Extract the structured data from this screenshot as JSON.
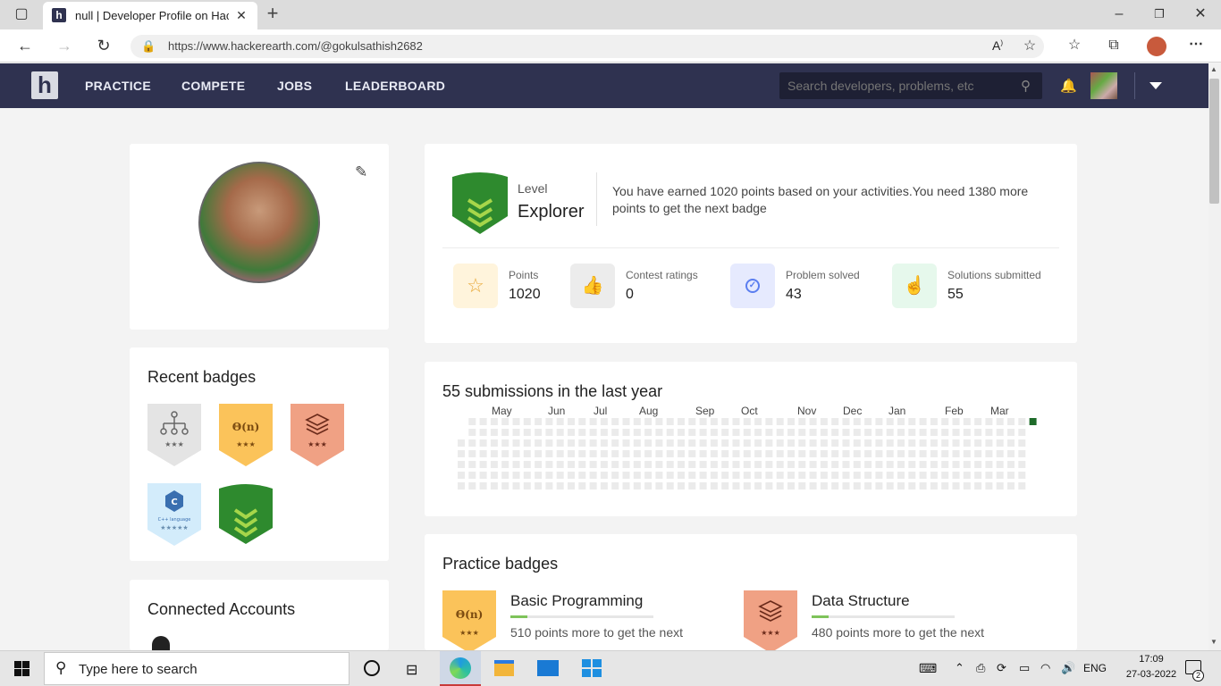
{
  "browser": {
    "tab_title": "null | Developer Profile on Hacke",
    "url": "https://www.hackerearth.com/@gokulsathish2682"
  },
  "nav": {
    "logo_letter": "h",
    "links": [
      "PRACTICE",
      "COMPETE",
      "JOBS",
      "LEADERBOARD"
    ],
    "search_placeholder": "Search developers, problems, etc"
  },
  "level": {
    "label": "Level",
    "name": "Explorer",
    "description": "You have earned 1020 points based on your activities.You need 1380 more points to get the next badge"
  },
  "stats": [
    {
      "label": "Points",
      "value": "1020",
      "icon": "star-icon",
      "color": "#fff4dc"
    },
    {
      "label": "Contest ratings",
      "value": "0",
      "icon": "thumbs-up-icon",
      "color": "#ececec"
    },
    {
      "label": "Problem solved",
      "value": "43",
      "icon": "check-circle-icon",
      "color": "#e6eafe"
    },
    {
      "label": "Solutions submitted",
      "value": "55",
      "icon": "hand-pointer-icon",
      "color": "#e6f8ec"
    }
  ],
  "submissions": {
    "title": "55 submissions in the last year",
    "months": [
      "May",
      "Jun",
      "Jul",
      "Aug",
      "Sep",
      "Oct",
      "Nov",
      "Dec",
      "Jan",
      "Feb",
      "Mar"
    ]
  },
  "recent_badges": {
    "title": "Recent badges",
    "badges": [
      {
        "name": "tree-badge",
        "glyph": "",
        "color": "#e4e4e4"
      },
      {
        "name": "complexity-badge",
        "glyph": "Θ(n)",
        "color": "#fbc35a"
      },
      {
        "name": "data-structure-badge",
        "glyph": "",
        "color": "#f0a184"
      },
      {
        "name": "cpp-badge",
        "glyph": "C++ language",
        "color": "#d3ecfb"
      },
      {
        "name": "explorer-badge",
        "glyph": "",
        "color": "#2e8a2e"
      }
    ]
  },
  "practice_badges": {
    "title": "Practice badges",
    "items": [
      {
        "name": "Basic Programming",
        "desc": "510 points more to get the next",
        "glyph": "Θ(n)",
        "color": "#fbc35a"
      },
      {
        "name": "Data Structure",
        "desc": "480 points more to get the next",
        "glyph": "",
        "color": "#f0a184"
      }
    ]
  },
  "connected": {
    "title": "Connected Accounts"
  },
  "taskbar": {
    "search_placeholder": "Type here to search",
    "lang": "ENG",
    "time": "17:09",
    "date": "27-03-2022",
    "notifications": "2"
  }
}
